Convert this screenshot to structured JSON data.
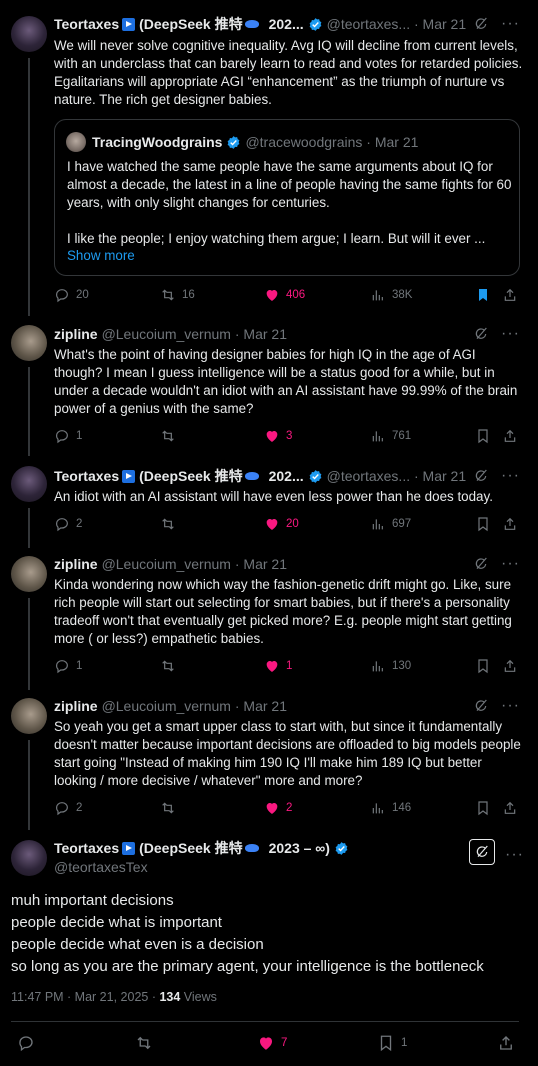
{
  "tweets": [
    {
      "display_name": "Teortaxes",
      "name_suffix": "(DeepSeek 推特",
      "name_tail": "202...",
      "handle": "@teortaxes...",
      "date": "Mar 21",
      "text": "We will never solve cognitive inequality.  Avg IQ will decline from current levels, with an underclass that can barely learn to read and votes for retarded policies. Egalitarians will appropriate AGI “enhancement” as the triumph of nurture vs nature. The rich get designer babies.",
      "quote": {
        "display_name": "TracingWoodgrains",
        "handle": "@tracewoodgrains",
        "date": "Mar 21",
        "text1": "I have watched the same people have the same arguments about IQ for almost a decade, the latest in a line of people having the same fights for 60 years, with only slight changes for centuries.",
        "text2": "I like the people; I enjoy watching them argue; I learn. But will it ever ...",
        "show_more": "Show more"
      },
      "replies": "20",
      "reposts": "16",
      "likes": "406",
      "views": "38K"
    },
    {
      "display_name": "zipline",
      "handle": "@Leucoium_vernum",
      "date": "Mar 21",
      "text": "What's the point of having designer babies for high IQ in the age of AGI though? I mean I guess intelligence will be a status good for a while, but in under a decade wouldn't an idiot with an AI assistant have 99.99% of the brain power of a genius with the same?",
      "replies": "1",
      "reposts": "",
      "likes": "3",
      "views": "761"
    },
    {
      "display_name": "Teortaxes",
      "name_suffix": "(DeepSeek 推特",
      "name_tail": "202...",
      "handle": "@teortaxes...",
      "date": "Mar 21",
      "text": "An idiot with an AI assistant will have even less power than he does today.",
      "replies": "2",
      "reposts": "",
      "likes": "20",
      "views": "697"
    },
    {
      "display_name": "zipline",
      "handle": "@Leucoium_vernum",
      "date": "Mar 21",
      "text": "Kinda wondering now which way the fashion-genetic drift might go. Like, sure rich people will start out selecting for smart babies, but if there's a personality tradeoff won't that eventually get picked more? E.g. people might start getting more ( or less?) empathetic babies.",
      "replies": "1",
      "reposts": "",
      "likes": "1",
      "views": "130"
    },
    {
      "display_name": "zipline",
      "handle": "@Leucoium_vernum",
      "date": "Mar 21",
      "text": "So yeah you get a smart upper class to start with, but since it fundamentally doesn't matter because important decisions are offloaded to big models people start going \"Instead of making him 190 IQ I'll make him 189 IQ but better looking / more decisive / whatever\" more and more?",
      "replies": "2",
      "reposts": "",
      "likes": "2",
      "views": "146"
    }
  ],
  "main": {
    "display_name": "Teortaxes",
    "name_suffix": "(DeepSeek 推特",
    "name_tail": "2023 – ∞)",
    "handle": "@teortaxesTex",
    "lines": [
      "muh important decisions",
      "people decide what is important",
      "people decide what even is a decision",
      "so long as you are the primary agent, your intelligence is the bottleneck"
    ],
    "timestamp": "11:47 PM · Mar 21, 2025 · ",
    "views_count": "134",
    "views_label": " Views",
    "replies": "",
    "reposts": "",
    "likes": "7",
    "bookmarks": "1"
  },
  "colors": {
    "background": "#000000",
    "text": "#e7e9ea",
    "muted": "#71767b",
    "like": "#f91880",
    "accent": "#1d9bf0",
    "border": "#2f3336"
  },
  "icons": [
    "reply-icon",
    "repost-icon",
    "heart-icon",
    "views-icon",
    "bookmark-icon",
    "share-icon",
    "grok-icon",
    "more-icon",
    "verified-icon"
  ]
}
